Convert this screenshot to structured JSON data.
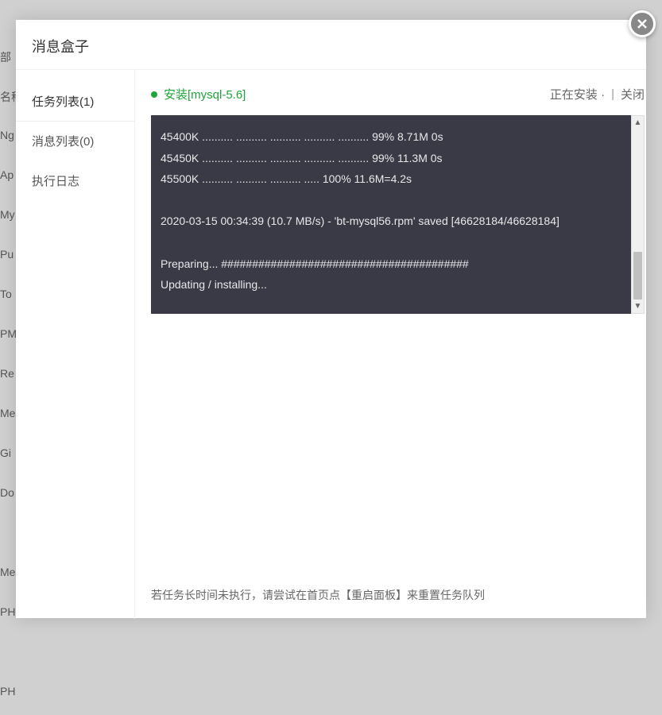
{
  "bg_items": [
    "部",
    "名称",
    "Ng",
    "Ap",
    "My",
    "Pu",
    "To",
    "PM",
    "Re",
    "Me",
    "Gi",
    "Do",
    "",
    "Me",
    "PH",
    "",
    "PH"
  ],
  "modal": {
    "title": "消息盒子",
    "sidebar": {
      "items": [
        {
          "label": "任务列表(1)",
          "active": true
        },
        {
          "label": "消息列表(0)",
          "active": false
        },
        {
          "label": "执行日志",
          "active": false
        }
      ]
    },
    "task": {
      "title": "安装[mysql-5.6]",
      "status": "正在安装 ·",
      "close_label": "关闭"
    },
    "terminal_lines": [
      "45400K .......... .......... .......... .......... .......... 99% 8.71M 0s",
      "45450K .......... .......... .......... .......... .......... 99% 11.3M 0s",
      "45500K .......... .......... .......... ..... 100% 11.6M=4.2s",
      "",
      "2020-03-15 00:34:39 (10.7 MB/s) - 'bt-mysql56.rpm' saved [46628184/46628184]",
      "",
      "Preparing... ########################################",
      "Updating / installing..."
    ],
    "footer_tip": "若任务长时间未执行，请尝试在首页点【重启面板】来重置任务队列"
  }
}
